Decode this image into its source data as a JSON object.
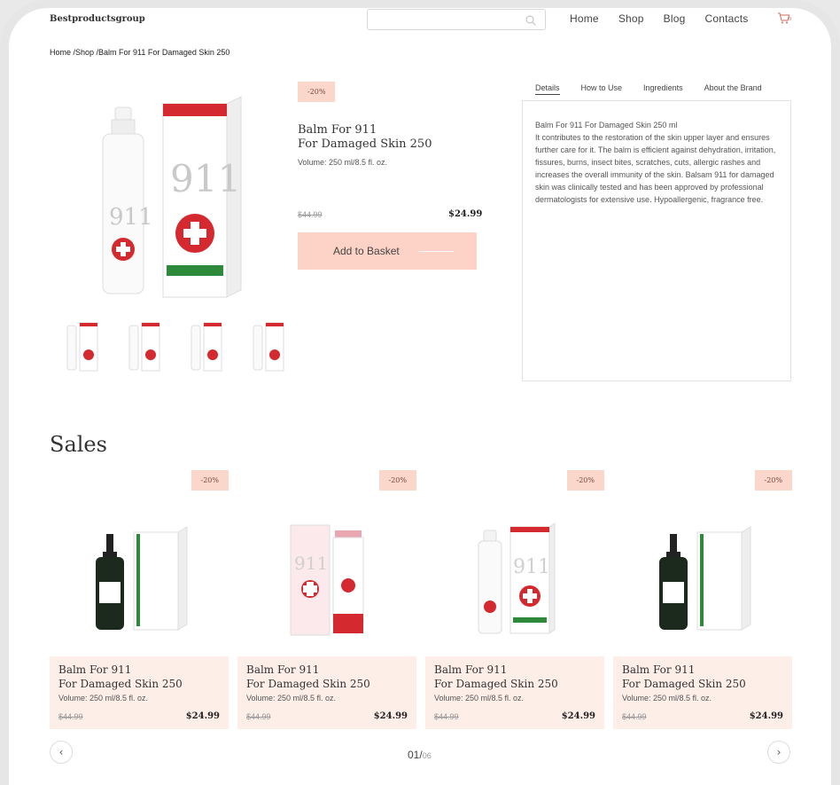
{
  "header": {
    "logo": "Bestproductsgroup",
    "search_placeholder": "",
    "nav": [
      "Home",
      "Shop",
      "Blog",
      "Contacts"
    ],
    "cart_count": "0"
  },
  "breadcrumb": "Home /Shop /Balm For 911 For Damaged Skin 250",
  "product": {
    "discount": "-20%",
    "title_line1": "Balm For 911",
    "title_line2": "For Damaged Skin 250",
    "volume": "Volume: 250 ml/8.5 fl. oz.",
    "old_price": "$44.99",
    "new_price": "$24.99",
    "add_button": "Add to Basket"
  },
  "tabs": [
    "Details",
    "How to Use",
    "Ingredients",
    "About the Brand"
  ],
  "details": {
    "heading": "Balm For 911 For Damaged Skin  250 ml",
    "text": "It contributes to the restoration of the skin upper layer and ensures further care for it. The balm is efficient against dehydration, irritation, fissures, burns, insect bites, scratches, cuts, allergic rashes and increases the overall immunity of the skin. Balsam 911 for damaged skin was clinically tested and has been approved by professional dermatologists for extensive use. Hypoallergenic, fragrance free."
  },
  "sales": {
    "title": "Sales",
    "cards": [
      {
        "discount": "-20%",
        "title1": "Balm For 911",
        "title2": "For Damaged Skin 250",
        "volume": "Volume: 250 ml/8.5 fl. oz.",
        "old": "$44.99",
        "new": "$24.99",
        "kind": "serum"
      },
      {
        "discount": "-20%",
        "title1": "Balm For 911",
        "title2": "For Damaged Skin 250",
        "volume": "Volume: 250 ml/8.5 fl. oz.",
        "old": "$44.99",
        "new": "$24.99",
        "kind": "tube"
      },
      {
        "discount": "-20%",
        "title1": "Balm For 911",
        "title2": "For Damaged Skin 250",
        "volume": "Volume: 250 ml/8.5 fl. oz.",
        "old": "$44.99",
        "new": "$24.99",
        "kind": "spray"
      },
      {
        "discount": "-20%",
        "title1": "Balm For 911",
        "title2": "For Damaged Skin 250",
        "volume": "Volume: 250 ml/8.5 fl. oz.",
        "old": "$44.99",
        "new": "$24.99",
        "kind": "serum"
      }
    ],
    "pager_current": "01/",
    "pager_total": "06"
  },
  "colors": {
    "accent": "#fcd3c6",
    "card_bg": "#fdeee8",
    "brand_red": "#d42a2f"
  }
}
